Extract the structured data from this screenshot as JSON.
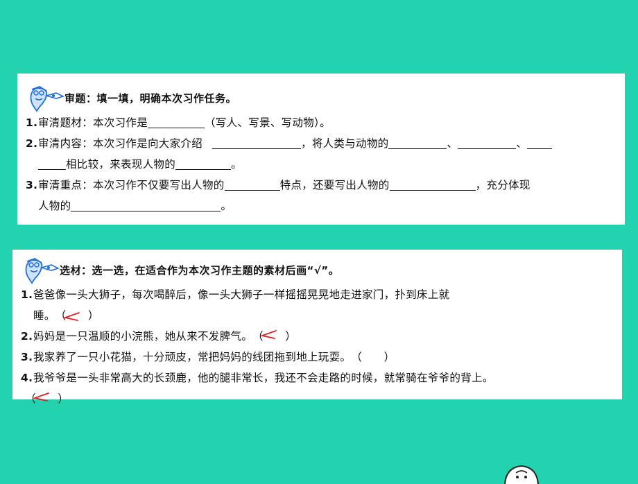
{
  "section1": {
    "heading": "审题：填一填，明确本次习作任务。",
    "items": [
      {
        "num": "1.",
        "pre": "审清题材：本次习作是",
        "post": "（写人、写景、写动物）。"
      },
      {
        "num": "2.",
        "pre": "审清内容：本次习作是向大家介绍",
        "mid1": "，将人类与动物的",
        "sep1": "、",
        "sep2": "、",
        "cont": "相比较，来表现人物的",
        "end": "。"
      },
      {
        "num": "3.",
        "pre": "审清重点：本次习作不仅要写出人物的",
        "mid1": "特点，还要写出人物的",
        "mid2": "，充分体现",
        "cont": "人物的",
        "end": "。"
      }
    ]
  },
  "section2": {
    "heading": "选材：选一选，在适合作为本次习作主题的素材后画“√”。",
    "items": [
      {
        "num": "1.",
        "text": "爸爸像一头大狮子，每次喝醉后，像一头大狮子一样摇摇晃晃地走进家门，扑到床上就",
        "cont": "睡。",
        "paren": "（　　）",
        "checked": true
      },
      {
        "num": "2.",
        "text": "妈妈是一只温顺的小浣熊，她从来不发脾气。",
        "paren": "（　　）",
        "checked": true
      },
      {
        "num": "3.",
        "text": "我家养了一只小花猫，十分顽皮，常把妈妈的线团拖到地上玩耍。",
        "paren": "（　　）",
        "checked": false
      },
      {
        "num": "4.",
        "text": "我爷爷是一头非常高大的长颈鹿，他的腿非常长，我还不会走路的时候，就常骑在爷爷的背上。",
        "paren": "（　　）",
        "checked": true
      }
    ]
  },
  "colors": {
    "background": "#23d3b0",
    "card": "#ffffff",
    "check_mark": "#e02020",
    "mascot": "#1e6fd9"
  },
  "icons": [
    "pencil-mascot-icon",
    "check-mark-icon"
  ]
}
